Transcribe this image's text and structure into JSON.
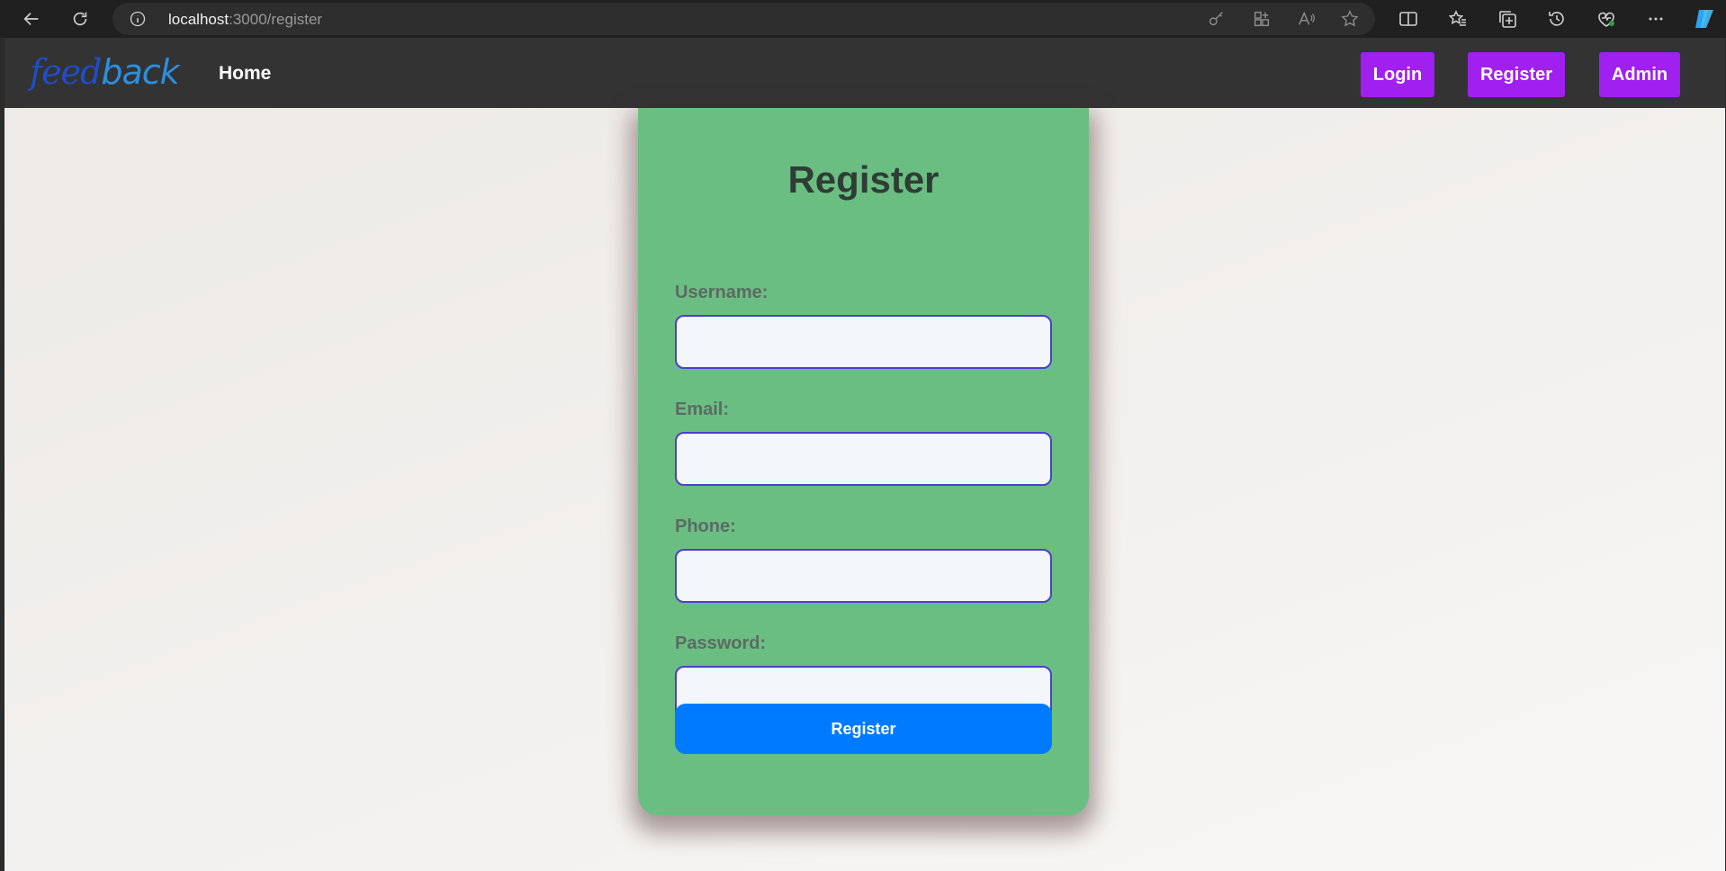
{
  "browser": {
    "url_host": "localhost",
    "url_path": ":3000/register"
  },
  "site": {
    "logo_part1": "feed",
    "logo_part2": "back",
    "nav_home": "Home",
    "buttons": {
      "login": "Login",
      "register": "Register",
      "admin": "Admin"
    },
    "accent_color": "#a020f0"
  },
  "form": {
    "title": "Register",
    "fields": [
      {
        "label": "Username:",
        "value": ""
      },
      {
        "label": "Email:",
        "value": ""
      },
      {
        "label": "Phone:",
        "value": ""
      },
      {
        "label": "Password:",
        "value": ""
      }
    ],
    "submit_label": "Register",
    "card_color": "#6bbe82",
    "submit_color": "#007bff"
  }
}
